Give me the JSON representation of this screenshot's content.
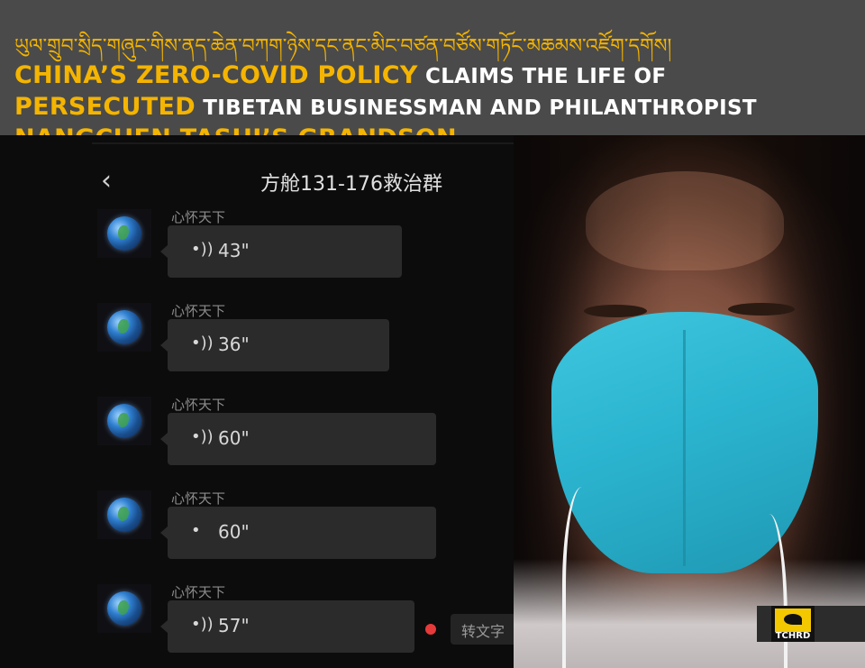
{
  "banner": {
    "tibetan_title": "ཡུལ་གྲུབ་སྲིད་གཞུང་གིས་ནད་ཆེན་བཀག་ཉེས་དང་ནང་མིང་བཙན་བཙོས་གཏོང་མཆམས་འཛོག་དགོས།",
    "headline": [
      {
        "text": "China’s Zero-COVID Policy",
        "color": "yellow"
      },
      {
        "text": " claims the life of ",
        "color": "white"
      },
      {
        "text": "persecuted",
        "color": "yellow"
      },
      {
        "text": " Tibetan businessman and philanthropist ",
        "color": "white"
      },
      {
        "text": "Nangchen Tashi’s Grandson",
        "color": "yellow"
      }
    ]
  },
  "chat": {
    "back_icon": "chevron-left-icon",
    "title": "方舱131-176救治群",
    "messages": [
      {
        "sender": "心怀天下",
        "icon": "voice-wave-icon",
        "wave": "•))",
        "duration": "43\""
      },
      {
        "sender": "心怀天下",
        "icon": "voice-wave-icon",
        "wave": "•))",
        "duration": "36\""
      },
      {
        "sender": "心怀天下",
        "icon": "voice-wave-icon",
        "wave": "•))",
        "duration": "60\""
      },
      {
        "sender": "心怀天下",
        "icon": "voice-wave-icon",
        "wave": "•",
        "duration": "60\""
      },
      {
        "sender": "心怀天下",
        "icon": "voice-wave-icon",
        "wave": "•))",
        "duration": "57\""
      }
    ],
    "convert_label": "转文字",
    "unread_color": "#e63a3a"
  },
  "logo": {
    "text": "TCHRD",
    "color": "#f4c800"
  },
  "colors": {
    "accent_yellow": "#f4b400",
    "banner_bg": "#4a4a4a",
    "mask": "#2bb4cf"
  }
}
